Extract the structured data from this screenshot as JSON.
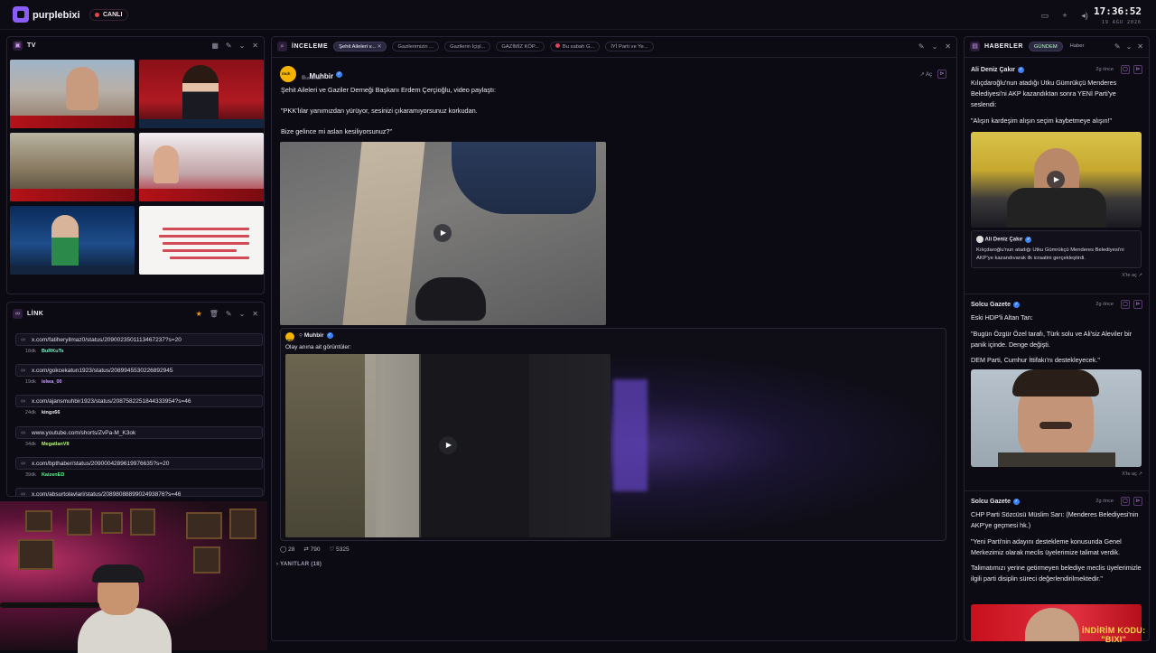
{
  "app": {
    "brand": "purplebixi",
    "live_label": "CANLI",
    "time": "17:36:52",
    "date": "19 AĞU 2026"
  },
  "tv": {
    "title": "TV"
  },
  "link": {
    "title": "LİNK",
    "items": [
      {
        "url": "x.com/fatiheryilmaz0/status/2090023501113467237?s=20",
        "ago": "18dk",
        "user": "BuRKuTs",
        "color": "#7ef0c8"
      },
      {
        "url": "x.com/gokcekatun1923/status/2089945530226892945",
        "ago": "19dk",
        "user": "lelwa_00",
        "color": "#c59bff"
      },
      {
        "url": "x.com/ajansmuhbir1923/status/2087582251844333954?s=46",
        "ago": "24dk",
        "user": "kingx66",
        "color": "#e6e4ee"
      },
      {
        "url": "www.youtube.com/shorts/ZvPa-M_K3ok",
        "ago": "34dk",
        "user": "MegatlanVII",
        "color": "#b9f27a"
      },
      {
        "url": "x.com/bpthaber/status/2090004289619976635?s=20",
        "ago": "39dk",
        "user": "KaizenED",
        "color": "#5ef08a"
      },
      {
        "url": "x.com/absurtolaylari/status/2089808889902493876?s=46",
        "ago": "",
        "user": "",
        "color": "#e6e4ee"
      }
    ]
  },
  "inceleme": {
    "title": "İNCELEME",
    "tabs": [
      "Şehit Aileleri v...",
      "Gazilerimizin ...",
      "Gazilerin İçişl...",
      "GAZİMİZ KÖP...",
      "Bu sabah G...",
      "İYİ Parti ve Ye..."
    ],
    "post": {
      "author": "Muhbir",
      "time": "6sa önce",
      "open": "Aç",
      "line1": "Şehit Aileleri ve Gaziler Derneği Başkanı Erdem Çerçioğlu, video paylaştı:",
      "line2": "\"PKK'lılar yanımızdan yürüyor, sesinizi çıkaramıyorsunuz korkudan.",
      "line3": "Bize gelince mi aslan kesiliyorsunuz?\"",
      "quote_author": "Muhbir",
      "quote_text": "Olay anına ait görüntüler:",
      "replies": "28",
      "retweets": "790",
      "likes": "5325",
      "replies_label": "YANITLAR (18)"
    }
  },
  "haberler": {
    "title": "HABERLER",
    "tabs": [
      "GÜNDEM",
      "Haber"
    ],
    "items": [
      {
        "author": "Ali Deniz Çakır",
        "ago": "2g önce",
        "text": "Kılıçdaroğlu'nun atadığı Utku Gümrükçü Menderes Belediyesi'ni AKP kazandıktan sonra YENİ Parti'ye seslendi:",
        "text2": "\"Alışın kardeşim alışın seçim kaybetmeye alışın!\"",
        "embed_author": "Ali Deniz Çakır",
        "embed_text": "Kılıçdaroğlu'nun atadığı Utku Gümrükçü Menderes Belediyesi'ni AKP'ye kazandıvarak ilk icraatini gerçekleştirdi.",
        "xopen": "X'te aç"
      },
      {
        "author": "Solcu Gazete",
        "ago": "2g önce",
        "text": "Eski HDP'li Altan Tan:",
        "text2": "\"Bugün Özgür Özel tarafı, Türk solu ve Ali'siz Aleviler bir panik içinde. Denge değişti.",
        "text3": "DEM Parti, Cumhur İttifakı'nı destekleyecek.\"",
        "xopen": "X'te aç"
      },
      {
        "author": "Solcu Gazete",
        "ago": "2g önce",
        "text": "CHP Parti Sözcüsü Müslim Sarı: (Menderes Belediyesi'nin AKP'ye geçmesi hk.)",
        "text2": "\"Yeni Parti'nin adayını destekleme konusunda Genel Merkezimiz olarak meclis üyelerimize talimat verdik.",
        "text3": "Talimatımızı yerine getirmeyen belediye meclis üyelerimizle ilgili parti disiplin süreci değerlendirilmektedir.\""
      }
    ]
  },
  "promo": {
    "line1": "İNDİRİM KODU:",
    "line2": "\"BIXI\""
  },
  "colors": {
    "accent": "#8b5cf6",
    "live": "#ef4444",
    "verified": "#3b82f6"
  },
  "icons": [
    "grid-icon",
    "edit-icon",
    "chevron-down-icon",
    "close-icon",
    "star-icon",
    "trash-icon",
    "play-icon",
    "comment-icon",
    "retweet-icon",
    "heart-icon",
    "link-icon"
  ]
}
